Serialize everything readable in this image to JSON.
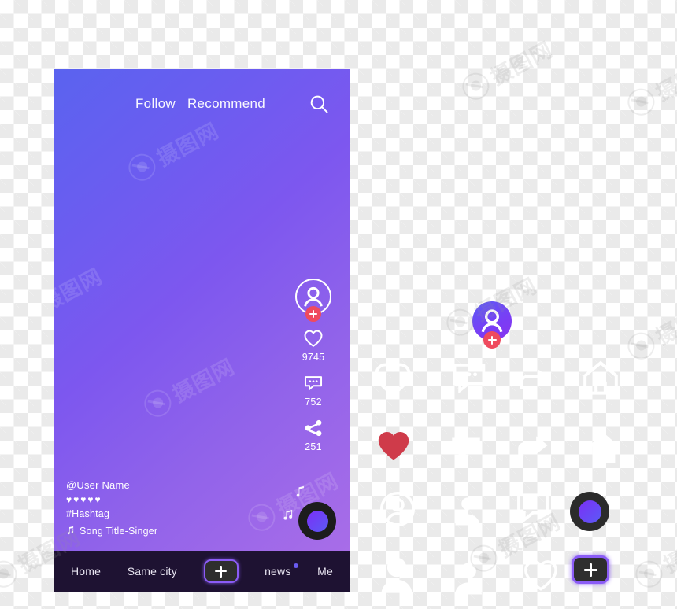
{
  "colors": {
    "screen_gradient_start": "#5a63ef",
    "screen_gradient_end": "#a86de8",
    "navbar_bg": "#1e1232",
    "accent_purple": "#8b5cf6",
    "badge_red": "#ef4a5e",
    "heart_red": "#cf3b4a",
    "news_dot": "#6a5bf0",
    "checker_gray": "#eaeaea"
  },
  "header": {
    "tabs": [
      {
        "label": "Follow",
        "icon": ""
      },
      {
        "label": "Recommend",
        "icon": ""
      }
    ],
    "search_icon": "search-icon"
  },
  "action_rail": {
    "avatar": {
      "icon": "user-avatar-icon",
      "badge_icon": "plus-icon",
      "label": ""
    },
    "items": [
      {
        "icon": "heart-icon",
        "count": "9745",
        "name": "like"
      },
      {
        "icon": "comment-icon",
        "count": "752",
        "name": "comment"
      },
      {
        "icon": "share-icon",
        "count": "251",
        "name": "share"
      }
    ]
  },
  "info": {
    "username": "@User Name",
    "hearts": "♥♥♥♥♥",
    "hashtag": "#Hashtag",
    "song_icon": "music-note-icon",
    "song": "Song Title-Singer"
  },
  "record": {
    "icon": "record-disc-icon",
    "floating_notes": [
      "music-note-icon",
      "music-note-icon"
    ]
  },
  "navbar": {
    "items": [
      {
        "label": "Home",
        "name": "home",
        "badge": false
      },
      {
        "label": "Same city",
        "name": "same-city",
        "badge": false
      },
      {
        "label": "news",
        "name": "news",
        "badge": true
      },
      {
        "label": "Me",
        "name": "me",
        "badge": false
      }
    ],
    "plus_icon": "plus-icon"
  },
  "assets": [
    {
      "name": "avatar-with-add-badge",
      "icon": "user-avatar-icon"
    },
    {
      "name": "heart",
      "icon": "heart-icon"
    },
    {
      "name": "record-disc",
      "icon": "record-disc-icon"
    },
    {
      "name": "add-button",
      "icon": "plus-icon"
    }
  ],
  "ghost_assets": [
    {
      "name": "heart-outline",
      "icon": "heart-icon"
    },
    {
      "name": "comment-outline",
      "icon": "comment-icon"
    },
    {
      "name": "share-outline",
      "icon": "share-icon"
    },
    {
      "name": "home-outline",
      "icon": "home-icon"
    },
    {
      "name": "home-filled",
      "icon": "home-icon"
    },
    {
      "name": "avatar-outline",
      "icon": "user-avatar-icon"
    },
    {
      "name": "avatar-filled",
      "icon": "user-avatar-icon"
    },
    {
      "name": "comment-filled",
      "icon": "comment-icon"
    },
    {
      "name": "share-filled",
      "icon": "share-icon"
    },
    {
      "name": "heart-filled",
      "icon": "heart-icon"
    }
  ],
  "watermark": {
    "text": "摄图网",
    "logo": "aperture-icon"
  }
}
